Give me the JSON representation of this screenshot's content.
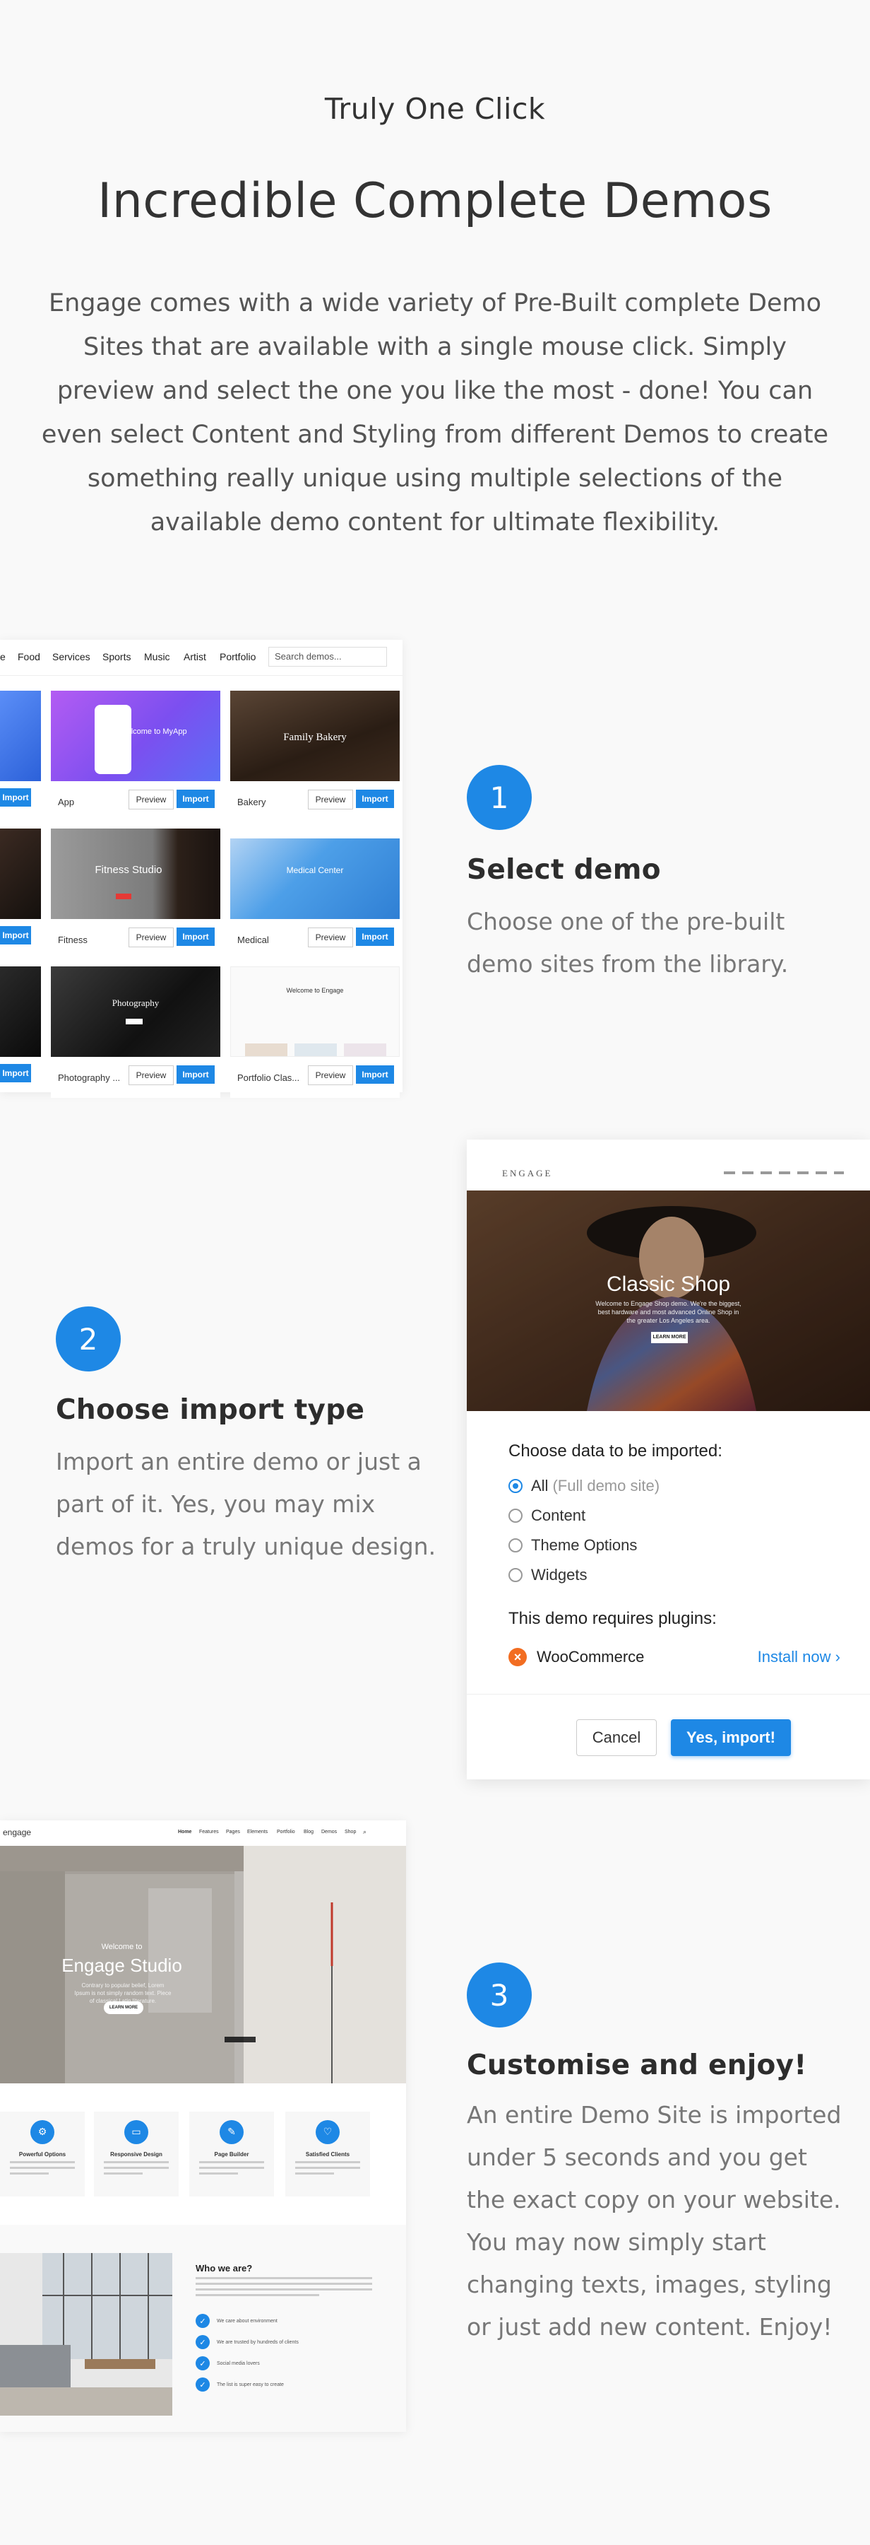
{
  "header": {
    "eyebrow": "Truly One Click",
    "headline": "Incredible Complete Demos",
    "intro": "Engage comes with a wide variety of Pre-Built complete Demo Sites that are available with a single mouse click. Simply preview and select the one you like the most - done! You can even select Content and Styling from different Demos to create something really unique using multiple selections of the available demo content for ultimate flexibility."
  },
  "colors": {
    "accent": "#1e88e5",
    "woo_icon": "#f26d21",
    "background": "#f9f9f9"
  },
  "steps": [
    {
      "number": "1",
      "title": "Select demo",
      "description": "Choose one of the pre-built demo sites from the library."
    },
    {
      "number": "2",
      "title": "Choose import type",
      "description": "Import an entire demo or just a part of it. Yes, you may mix demos for a truly unique design."
    },
    {
      "number": "3",
      "title": "Customise and enjoy!",
      "description": "An entire Demo Site is imported under 5 seconds and you get the exact copy on your website. You may now simply start changing texts, images, styling or just add new content. Enjoy!"
    }
  ],
  "library": {
    "categories": [
      "e",
      "Food",
      "Services",
      "Sports",
      "Music",
      "Artist",
      "Portfolio"
    ],
    "search_placeholder": "Search demos...",
    "preview_label": "Preview",
    "import_label": "Import",
    "cards": [
      {
        "name": "App",
        "thumb_title": "Welcome to MyApp"
      },
      {
        "name": "Bakery",
        "thumb_title": "Family Bakery"
      },
      {
        "name": "Fitness",
        "thumb_title": "Fitness Studio"
      },
      {
        "name": "Medical",
        "thumb_title": "Medical Center"
      },
      {
        "name": "Photography ...",
        "thumb_title": "Photography"
      },
      {
        "name": "Portfolio Clas...",
        "thumb_title": "Welcome to Engage"
      }
    ]
  },
  "import_dialog": {
    "site_logo": "ENGAGE",
    "hero_title": "Classic Shop",
    "hero_subtitle": "Welcome to Engage Shop demo. We're the biggest, best hardware and most advanced Online Shop in the greater Los Angeles area.",
    "hero_button": "LEARN MORE",
    "choose_heading": "Choose data to be imported:",
    "options": [
      {
        "label": "All",
        "note": "(Full demo site)",
        "selected": true
      },
      {
        "label": "Content",
        "note": "",
        "selected": false
      },
      {
        "label": "Theme Options",
        "note": "",
        "selected": false
      },
      {
        "label": "Widgets",
        "note": "",
        "selected": false
      }
    ],
    "plugins_heading": "This demo requires plugins:",
    "plugin_name": "WooCommerce",
    "install_label": "Install now",
    "cancel_label": "Cancel",
    "confirm_label": "Yes, import!"
  },
  "website_preview": {
    "logo": "engage",
    "nav": [
      "Home",
      "Features",
      "Pages",
      "Elements",
      "Portfolio",
      "Blog",
      "Demos",
      "Shop"
    ],
    "welcome": "Welcome to",
    "hero_title": "Engage Studio",
    "hero_subtitle": "Contrary to popular belief, Lorem Ipsum is not simply random text. Piece of classical Latin literature.",
    "hero_button": "LEARN MORE",
    "features": [
      "Powerful Options",
      "Responsive Design",
      "Page Builder",
      "Satisfied Clients"
    ],
    "who_title": "Who we are?",
    "who_items": [
      "We care about environment",
      "We are trusted by hundreds of clients",
      "Social media lovers",
      "The list is super easy to create"
    ]
  }
}
